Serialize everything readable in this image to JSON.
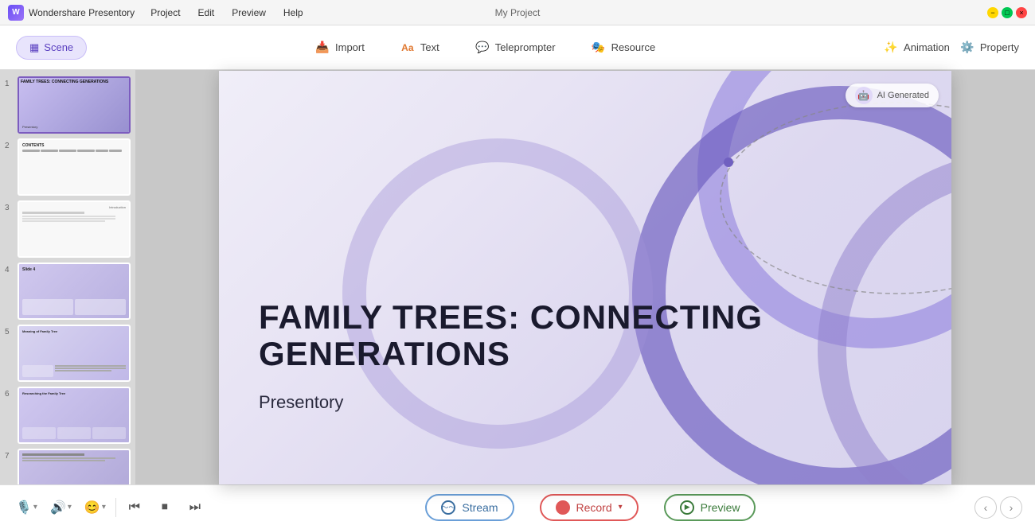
{
  "app": {
    "name": "Wondershare Presentory",
    "title": "My Project"
  },
  "title_bar": {
    "menu": [
      "Project",
      "Edit",
      "Preview",
      "Help"
    ],
    "controls": [
      "minimize",
      "maximize",
      "close"
    ]
  },
  "toolbar": {
    "scene_label": "Scene",
    "items": [
      {
        "id": "import",
        "label": "Import",
        "icon": "📥"
      },
      {
        "id": "text",
        "label": "Text",
        "icon": "Aa"
      },
      {
        "id": "teleprompter",
        "label": "Teleprompter",
        "icon": "💬"
      },
      {
        "id": "resource",
        "label": "Resource",
        "icon": "🎭"
      }
    ],
    "right_items": [
      {
        "id": "animation",
        "label": "Animation",
        "icon": "✨"
      },
      {
        "id": "property",
        "label": "Property",
        "icon": "⚙️"
      }
    ]
  },
  "slides": [
    {
      "number": "1",
      "active": true,
      "title": "FAMILY TREES: CONNECTING GENERATIONS",
      "subtitle": "Presentory"
    },
    {
      "number": "2",
      "active": false,
      "title": "CONTENTS",
      "subtitle": ""
    },
    {
      "number": "3",
      "active": false,
      "title": "",
      "subtitle": "Introduction"
    },
    {
      "number": "4",
      "active": false,
      "title": "",
      "subtitle": ""
    },
    {
      "number": "5",
      "active": false,
      "title": "Meaning of Family Tree",
      "subtitle": ""
    },
    {
      "number": "6",
      "active": false,
      "title": "Researching the Family Tree",
      "subtitle": ""
    },
    {
      "number": "7",
      "active": false,
      "title": "",
      "subtitle": ""
    }
  ],
  "canvas": {
    "title": "FAMILY TREES: CONNECTING GENERATIONS",
    "subtitle": "Presentory"
  },
  "bottom_bar": {
    "stream_label": "Stream",
    "record_label": "Record",
    "preview_label": "Preview"
  }
}
